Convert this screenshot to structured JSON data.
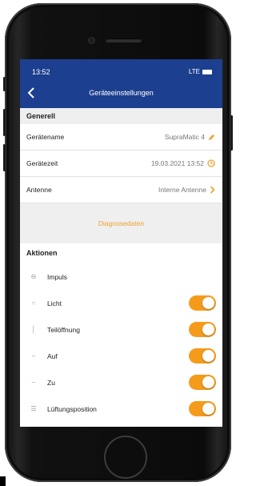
{
  "status_bar": {
    "time": "13:52",
    "signal": "LTE"
  },
  "nav": {
    "back_icon": "chevron-left-icon",
    "title": "Geräteeinstellungen"
  },
  "general": {
    "header": "Generell",
    "rows": [
      {
        "label": "Gerätename",
        "value": "SupraMatic 4",
        "icon": "pencil-icon"
      },
      {
        "label": "Gerätezeit",
        "value": "19.03.2021 13:52",
        "icon": "clock-icon"
      },
      {
        "label": "Antenne",
        "value": "Interne Antenne",
        "icon": "chevron-right-icon"
      }
    ]
  },
  "diagnosis": {
    "label": "Diagnosedaten"
  },
  "actions": {
    "header": "Aktionen",
    "impulse": {
      "label": "Impuls",
      "icon": "impulse-icon"
    },
    "rows": [
      {
        "label": "Licht",
        "icon": "light-icon",
        "enabled": true
      },
      {
        "label": "Teilöffnung",
        "icon": "partial-open-icon",
        "enabled": true
      },
      {
        "label": "Auf",
        "icon": "up-icon",
        "enabled": true
      },
      {
        "label": "Zu",
        "icon": "down-icon",
        "enabled": true
      },
      {
        "label": "Lüftungsposition",
        "icon": "ventilation-icon",
        "enabled": true
      }
    ]
  },
  "colors": {
    "nav_bar": "#1d3f8f",
    "accent": "#f59b1b",
    "section_bg": "#efefef"
  }
}
